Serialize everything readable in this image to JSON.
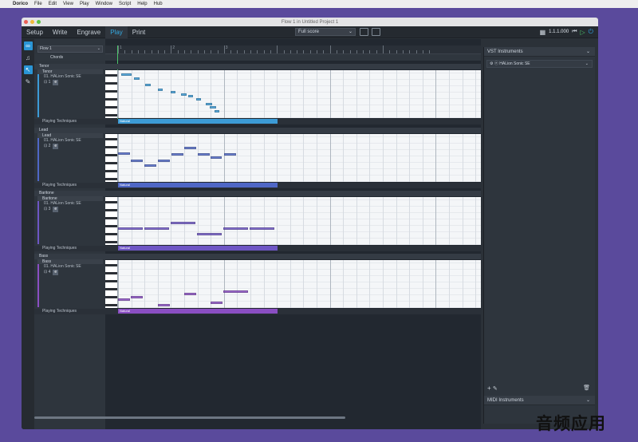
{
  "menubar": {
    "apple": "",
    "app": "Dorico",
    "items": [
      "File",
      "Edit",
      "View",
      "Play",
      "Window",
      "Script",
      "Help",
      "Hub"
    ]
  },
  "window": {
    "title": "Flow 1 in Untitled Project 1"
  },
  "toolbar": {
    "modes": [
      "Setup",
      "Write",
      "Engrave",
      "Play",
      "Print"
    ],
    "active_mode": "Play",
    "layout_select": "Full score",
    "position": "1.1.1.000"
  },
  "flow_select": "Flow 1",
  "chords_label": "Chords",
  "ruler": {
    "bars": [
      "1",
      "2",
      "3"
    ]
  },
  "tracks": [
    {
      "group": "Tenor",
      "name": "Tenor",
      "sound": "01. HALion Sonic SE",
      "channel": "1",
      "pt_label": "Playing Techniques",
      "region_label": "Natural",
      "color": "#3c9bd6",
      "notes": [
        [
          4,
          20,
          13
        ],
        [
          9,
          36,
          7
        ],
        [
          17,
          50,
          7
        ],
        [
          23,
          66,
          6
        ],
        [
          26,
          82,
          6
        ],
        [
          29,
          95,
          7
        ],
        [
          31,
          104,
          6
        ],
        [
          35,
          114,
          6
        ],
        [
          41,
          126,
          8
        ],
        [
          45,
          131,
          8
        ],
        [
          50,
          137,
          6
        ]
      ]
    },
    {
      "group": "Lead",
      "name": "Lead",
      "sound": "01. HALion Sonic SE",
      "channel": "2",
      "pt_label": "Playing Techniques",
      "region_label": "Natural",
      "color": "#4f67c6",
      "notes": [
        [
          23,
          16,
          15
        ],
        [
          32,
          32,
          15
        ],
        [
          38,
          49,
          15
        ],
        [
          32,
          66,
          15
        ],
        [
          24,
          83,
          15
        ],
        [
          16,
          99,
          15
        ],
        [
          24,
          116,
          15
        ],
        [
          28,
          132,
          14
        ],
        [
          24,
          149,
          15
        ]
      ]
    },
    {
      "group": "Baritone",
      "name": "Baritone",
      "sound": "01. HALion Sonic SE",
      "channel": "3",
      "pt_label": "Playing Techniques",
      "region_label": "Natural",
      "color": "#6e56c4",
      "notes": [
        [
          38,
          16,
          31
        ],
        [
          38,
          49,
          31
        ],
        [
          31,
          82,
          31
        ],
        [
          45,
          115,
          31
        ],
        [
          38,
          148,
          31
        ],
        [
          38,
          181,
          31
        ]
      ]
    },
    {
      "group": "Bass",
      "name": "Bass",
      "sound": "01. HALion Sonic SE",
      "channel": "4",
      "pt_label": "Playing Techniques",
      "region_label": "Natural",
      "color": "#8a4ec2",
      "notes": [
        [
          48,
          16,
          15
        ],
        [
          45,
          32,
          15
        ],
        [
          55,
          66,
          15
        ],
        [
          41,
          99,
          15
        ],
        [
          52,
          132,
          15
        ],
        [
          38,
          148,
          31
        ],
        [
          60,
          181,
          31
        ]
      ]
    }
  ],
  "right_panel": {
    "vst_title": "VST Instruments",
    "vst_instrument": "HALion Sonic SE",
    "midi_title": "MIDI Instruments"
  },
  "watermark": "音频应用"
}
